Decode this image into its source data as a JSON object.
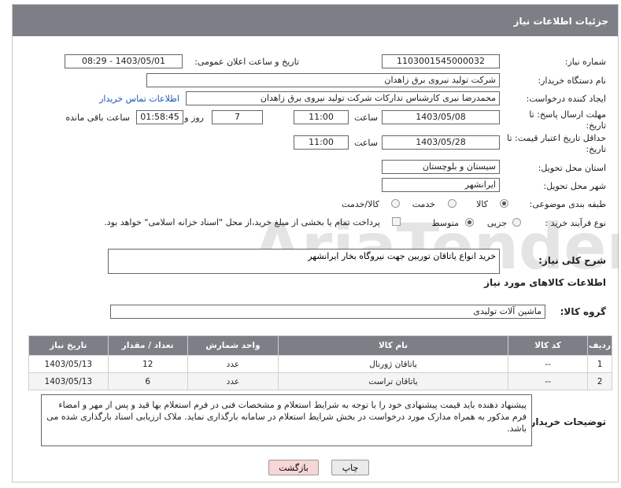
{
  "header": {
    "title": "جزئیات اطلاعات نیاز"
  },
  "form": {
    "need_number_label": "شماره نیاز:",
    "need_number": "1103001545000032",
    "announce_label": "تاریخ و ساعت اعلان عمومی:",
    "announce_value": "1403/05/01 - 08:29",
    "buyer_label": "نام دستگاه خریدار:",
    "buyer_value": "شرکت تولید نیروی برق زاهدان",
    "creator_label": "ایجاد کننده درخواست:",
    "creator_value": "محمدرضا نیری کارشناس تدارکات شرکت تولید نیروی برق زاهدان",
    "contact_link": "اطلاعات تماس خریدار",
    "deadline_label_1": "مهلت ارسال پاسخ: تا",
    "deadline_label_2": "تاریخ:",
    "deadline_date": "1403/05/08",
    "time_label": "ساعت",
    "deadline_time": "11:00",
    "days_value": "7",
    "days_label": "روز و",
    "remaining_time": "01:58:45",
    "remaining_label": "ساعت باقی مانده",
    "validity_label_1": "حداقل تاریخ اعتبار قیمت: تا",
    "validity_label_2": "تاریخ:",
    "validity_date": "1403/05/28",
    "validity_time": "11:00",
    "province_label": "استان محل تحویل:",
    "province_value": "سیستان و بلوچستان",
    "city_label": "شهر محل تحویل:",
    "city_value": "ایرانشهر",
    "category_label": "طبقه بندی موضوعی:",
    "category_options": [
      "کالا",
      "خدمت",
      "کالا/خدمت"
    ],
    "process_label": "نوع فرآیند خرید :",
    "process_options": [
      "جزیی",
      "متوسط"
    ],
    "payment_note": "پرداخت تمام یا بخشی از مبلغ خرید،از محل \"اسناد خزانه اسلامی\" خواهد بود.",
    "description_label": "شرح کلی نیاز:",
    "description_value": "خرید انواع یاتاقان توربین جهت نیروگاه بخار ایرانشهر"
  },
  "goods": {
    "section_title": "اطلاعات کالاهای مورد نیاز",
    "group_label": "گروه کالا:",
    "group_value": "ماشین آلات تولیدی",
    "columns": [
      "ردیف",
      "کد کالا",
      "نام کالا",
      "واحد شمارش",
      "تعداد / مقدار",
      "تاریخ نیاز"
    ],
    "rows": [
      {
        "row": "1",
        "code": "--",
        "name": "یاتاقان ژورنال",
        "unit": "عدد",
        "qty": "12",
        "date": "1403/05/13"
      },
      {
        "row": "2",
        "code": "--",
        "name": "یاتاقان تراست",
        "unit": "عدد",
        "qty": "6",
        "date": "1403/05/13"
      }
    ]
  },
  "buyer_notes": {
    "label": "توضیحات خریدار:",
    "text": "پیشنهاد دهنده باید قیمت پیشنهادی خود را با توجه به شرایط استعلام و مشخصات فنی در فرم استعلام بها قید و پس از مهر و امضاء فرم مذکور به همراه مدارک مورد درخواست در بخش شرایط استعلام در سامانه بارگذاری نماید. ملاک ارزیابی اسناد بارگذاری شده می باشد."
  },
  "buttons": {
    "print": "چاپ",
    "back": "بازگشت"
  },
  "watermark": "AriaTender.neT",
  "colors": {
    "header": "#7c7f86",
    "link": "#1a57b8",
    "back_button": "#f7d6d6",
    "print_button": "#eaeaea"
  }
}
